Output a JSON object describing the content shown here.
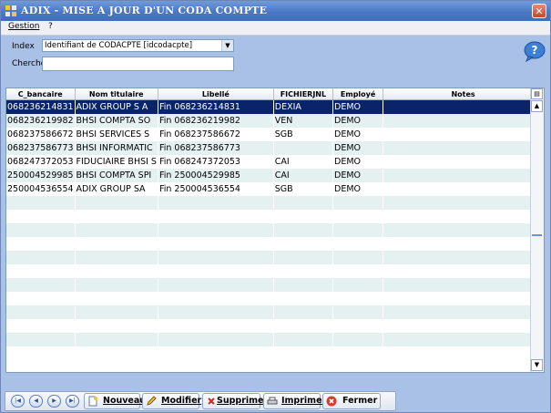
{
  "window": {
    "title": "ADIX - MISE A JOUR D'UN CODA COMPTE",
    "close_label": "✕"
  },
  "menu": {
    "items": [
      "Gestion",
      "?"
    ]
  },
  "form": {
    "index_label": "Index",
    "index_value": "Identifiant de CODACPTE  [idcodacpte]",
    "search_label": "Cherche",
    "search_value": ""
  },
  "grid": {
    "columns": [
      "C_bancaire",
      "Nom titulaire",
      "Libellé",
      "FICHIERJNL",
      "Employé",
      "Notes"
    ],
    "rows": [
      [
        "068236214831",
        "ADIX GROUP S A",
        "Fin 068236214831",
        "DEXIA",
        "DEMO",
        ""
      ],
      [
        "068236219982",
        "BHSI COMPTA SO",
        "Fin 068236219982",
        "VEN",
        "DEMO",
        ""
      ],
      [
        "068237586672",
        "BHSI SERVICES S",
        "Fin 068237586672",
        "SGB",
        "DEMO",
        ""
      ],
      [
        "068237586773",
        "BHSI INFORMATIC",
        "Fin 068237586773",
        "",
        "DEMO",
        ""
      ],
      [
        "068247372053",
        "FIDUCIAIRE BHSI S",
        "Fin 068247372053",
        "CAI",
        "DEMO",
        ""
      ],
      [
        "250004529985",
        "BHSI COMPTA SPI",
        "Fin 250004529985",
        "CAI",
        "DEMO",
        ""
      ],
      [
        "250004536554",
        "ADIX GROUP SA",
        "Fin 250004536554",
        "SGB",
        "DEMO",
        ""
      ]
    ],
    "selected_row": 0,
    "total_visible_rows": 19
  },
  "toolbar": {
    "nav": [
      "first-record",
      "previous-record",
      "next-record",
      "last-record"
    ],
    "buttons": [
      {
        "label": "Nouveau",
        "icon": "new-document-icon"
      },
      {
        "label": "Modifier",
        "icon": "pencil-icon"
      },
      {
        "label": "Supprimer",
        "icon": "delete-x-icon"
      },
      {
        "label": "Imprimer",
        "icon": "printer-icon"
      },
      {
        "label": "Fermer",
        "icon": "close-circle-icon"
      }
    ]
  },
  "colors": {
    "titlebar": "#4b79c8",
    "selection": "#0a246a",
    "alt_row": "#e5f1f1",
    "window_bg": "#a9c1e6"
  }
}
